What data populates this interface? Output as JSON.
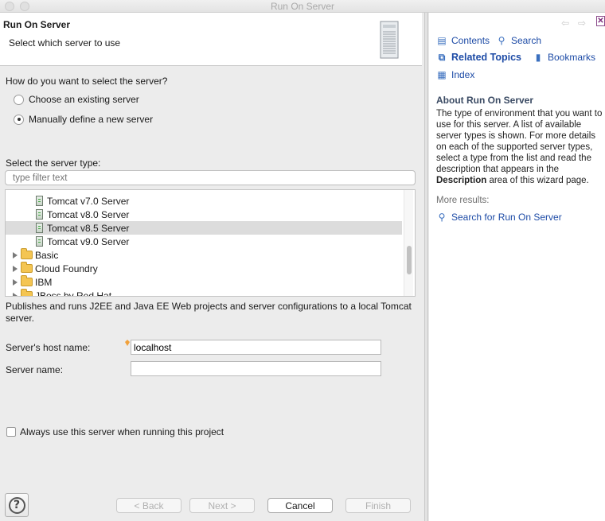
{
  "window": {
    "title": "Run On Server"
  },
  "header": {
    "title": "Run On Server",
    "subtitle": "Select which server to use"
  },
  "selection": {
    "question": "How do you want to select the server?",
    "options": [
      {
        "label": "Choose an existing server",
        "checked": false
      },
      {
        "label": "Manually define a new server",
        "checked": true
      }
    ]
  },
  "server_type": {
    "label": "Select the server type:",
    "filter_placeholder": "type filter text",
    "items": [
      {
        "label": "Tomcat v7.0 Server",
        "kind": "server"
      },
      {
        "label": "Tomcat v8.0 Server",
        "kind": "server"
      },
      {
        "label": "Tomcat v8.5 Server",
        "kind": "server",
        "selected": true
      },
      {
        "label": "Tomcat v9.0 Server",
        "kind": "server"
      },
      {
        "label": "Basic",
        "kind": "folder"
      },
      {
        "label": "Cloud Foundry",
        "kind": "folder"
      },
      {
        "label": "IBM",
        "kind": "folder"
      },
      {
        "label": "JBoss by Red Hat",
        "kind": "folder"
      }
    ]
  },
  "description": "Publishes and runs J2EE and Java EE Web projects and server configurations to a local Tomcat server.",
  "fields": {
    "host_label": "Server's host name:",
    "host_value": "localhost",
    "name_label": "Server name:",
    "name_value": ""
  },
  "always_use": {
    "label": "Always use this server when running this project",
    "checked": false
  },
  "buttons": {
    "back": "< Back",
    "next": "Next >",
    "cancel": "Cancel",
    "finish": "Finish"
  },
  "help": {
    "contents": "Contents",
    "search": "Search",
    "related_topics": "Related Topics",
    "bookmarks": "Bookmarks",
    "index": "Index",
    "about_title": "About Run On Server",
    "about_text_1": "The type of environment that you want to use for this server. A list of available server types is shown. For more details on each of the supported server types, select a type from the list and read the description that appears in the ",
    "about_bold": "Description",
    "about_text_2": " area of this wizard page.",
    "more_results": "More results:",
    "search_for": "Search for Run On Server"
  },
  "colors": {
    "link": "#1d4ba6",
    "selection": "#dcdcdc",
    "folder": "#f4c552"
  }
}
